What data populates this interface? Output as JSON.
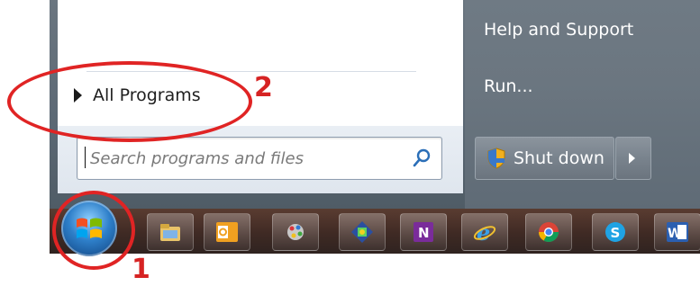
{
  "start_menu": {
    "all_programs_label": "All Programs",
    "search_placeholder": "Search programs and files",
    "right_pane": {
      "help_label": "Help and Support",
      "run_label": "Run...",
      "shutdown_label": "Shut down"
    }
  },
  "taskbar": {
    "pinned_apps": [
      {
        "name": "file-explorer-icon"
      },
      {
        "name": "outlook-icon"
      },
      {
        "name": "paint-icon"
      },
      {
        "name": "network-icon"
      },
      {
        "name": "onenote-icon"
      },
      {
        "name": "internet-explorer-icon"
      },
      {
        "name": "chrome-icon"
      },
      {
        "name": "skype-icon"
      },
      {
        "name": "word-icon"
      }
    ]
  },
  "annotations": {
    "label_1": "1",
    "label_2": "2",
    "color": "#e02424"
  }
}
